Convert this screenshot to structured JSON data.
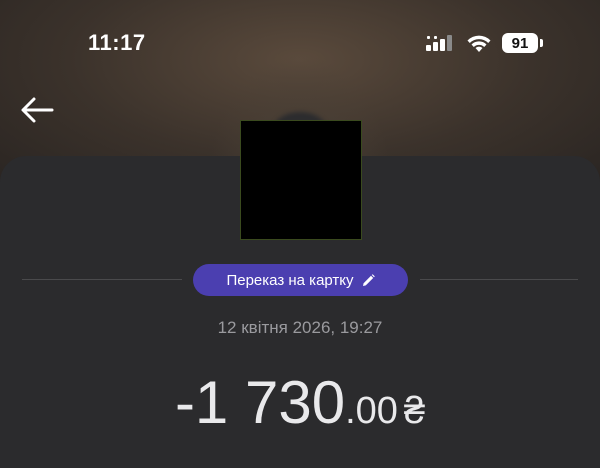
{
  "status_bar": {
    "time": "11:17",
    "battery": "91"
  },
  "transaction": {
    "type_label": "Переказ на картку",
    "date": "12 квітня 2026, 19:27",
    "amount_main": "-1 730",
    "amount_cents": ".00",
    "currency": "₴"
  },
  "icons": {
    "back": "arrow-left-icon",
    "edit": "pencil-icon",
    "signal": "cellular-signal-icon",
    "wifi": "wifi-icon"
  },
  "colors": {
    "badge": "#4b3fb0",
    "sheet": "#2b2b2d",
    "amount": "#e9e9eb",
    "date": "#9a9a9e"
  }
}
